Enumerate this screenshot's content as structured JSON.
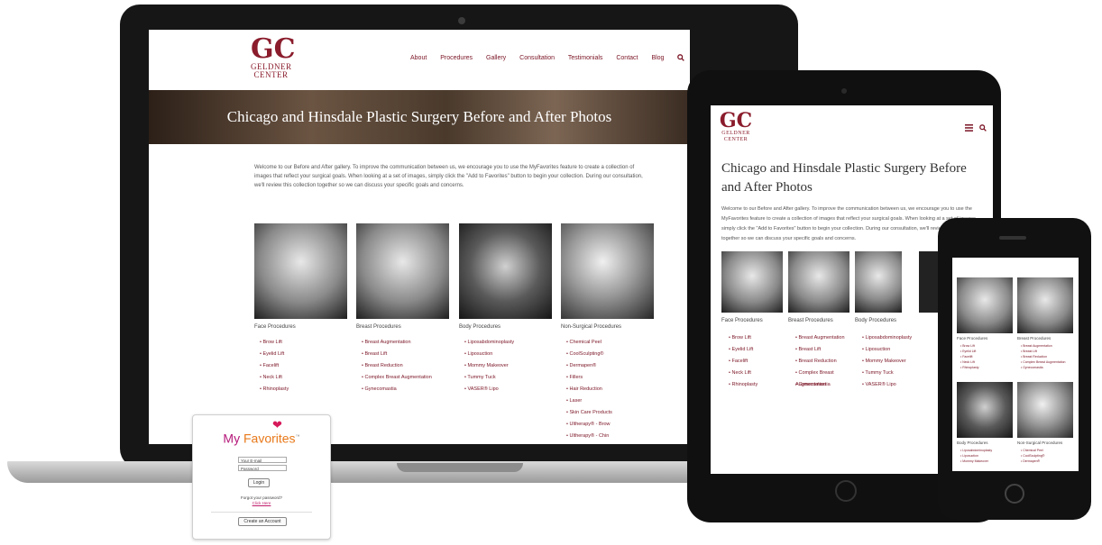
{
  "site": {
    "logo_monogram": "GC",
    "logo_name_line1": "GELDNER",
    "logo_name_line2": "CENTER",
    "nav": [
      "About",
      "Procedures",
      "Gallery",
      "Consultation",
      "Testimonials",
      "Contact",
      "Blog"
    ],
    "hero_title": "Chicago and Hinsdale Plastic Surgery Before and After Photos",
    "intro": "Welcome to our Before and After gallery. To improve the communication between us, we encourage you to use the MyFavorites feature to create a collection of images that reflect your surgical goals. When looking at a set of images, simply click the \"Add to Favorites\" button to begin your collection. During our consultation, we'll review this collection together so we can discuss your specific goals and concerns.",
    "categories": [
      {
        "title": "Face Procedures",
        "items": [
          "Brow Lift",
          "Eyelid Lift",
          "Facelift",
          "Neck Lift",
          "Rhinoplasty"
        ]
      },
      {
        "title": "Breast Procedures",
        "items": [
          "Breast Augmentation",
          "Breast Lift",
          "Breast Reduction",
          "Complex Breast Augmentation",
          "Gynecomastia"
        ]
      },
      {
        "title": "Body Procedures",
        "items": [
          "Liposabdominoplasty",
          "Liposuction",
          "Mommy Makeover",
          "Tummy Tuck",
          "VASER® Lipo"
        ]
      },
      {
        "title": "Non-Surgical Procedures",
        "items": [
          "Chemical Peel",
          "CoolSculpting®",
          "Dermapen®",
          "Fillers",
          "Hair Reduction",
          "Laser",
          "Skin Care Products",
          "Ultherapy® - Brow",
          "Ultherapy® - Chin"
        ]
      }
    ]
  },
  "tablet": {
    "title": "Chicago and Hinsdale Plastic Surgery Before and After Photos",
    "menu_icon": "hamburger-icon",
    "search_icon": "search-icon"
  },
  "favorites": {
    "title_my": "My",
    "title_favorites": "Favorites",
    "trademark": "™",
    "email_placeholder": "Your E-mail",
    "password_placeholder": "Password",
    "login_label": "Login",
    "forgot_text": "Forgot your password?",
    "click_here": "Click Here",
    "create_account": "Create an Account"
  },
  "colors": {
    "brand": "#7a1424",
    "favorites_pink": "#b5197a",
    "favorites_orange": "#e8791a"
  }
}
